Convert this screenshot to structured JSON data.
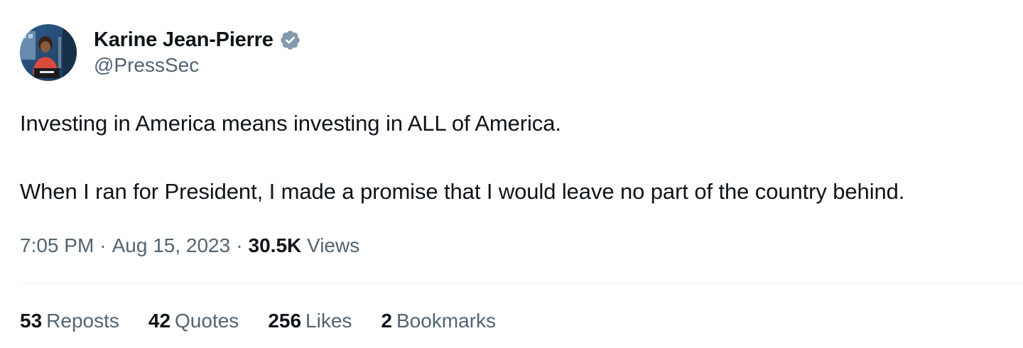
{
  "author": {
    "name": "Karine Jean-Pierre",
    "handle": "@PressSec",
    "verified_badge_color": "#829aab",
    "avatar_icon": "profile-photo-icon"
  },
  "tweet": {
    "lines": [
      "Investing in America means investing in ALL of America.",
      "When I ran for President, I made a promise that I would leave no part of the country behind."
    ]
  },
  "meta": {
    "time": "7:05 PM",
    "date": "Aug 15, 2023",
    "separator": "·",
    "views_count": "30.5K",
    "views_label": "Views"
  },
  "stats": [
    {
      "count": "53",
      "label": "Reposts"
    },
    {
      "count": "42",
      "label": "Quotes"
    },
    {
      "count": "256",
      "label": "Likes"
    },
    {
      "count": "2",
      "label": "Bookmarks"
    }
  ],
  "colors": {
    "text_primary": "#0f1419",
    "text_secondary": "#536471",
    "divider": "#eff3f4"
  }
}
